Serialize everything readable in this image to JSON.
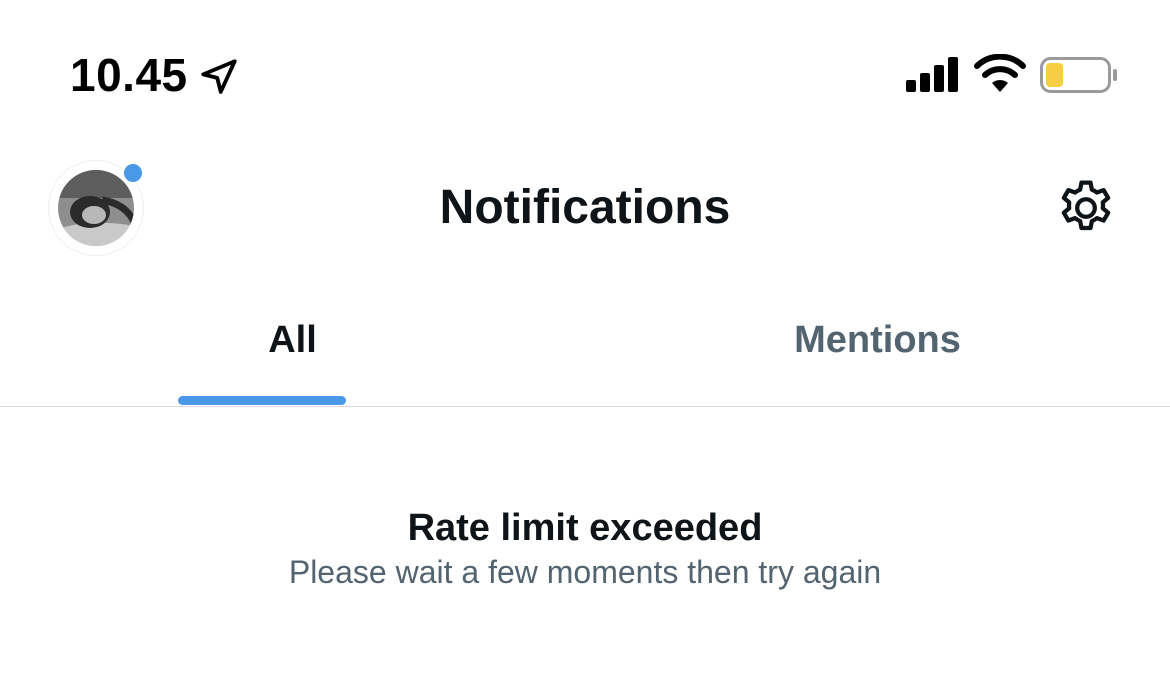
{
  "status_bar": {
    "time": "10.45",
    "icons": [
      "location-arrow-icon",
      "cellular-signal-icon",
      "wifi-icon",
      "battery-icon"
    ],
    "battery_color": "#f5ce42"
  },
  "header": {
    "title": "Notifications",
    "avatar": "profile-avatar",
    "notification_dot_color": "#4a99e9",
    "settings_icon": "gear-icon"
  },
  "tabs": {
    "items": [
      {
        "label": "All",
        "selected": true
      },
      {
        "label": "Mentions",
        "selected": false
      }
    ],
    "indicator_color": "#4a99e9"
  },
  "message": {
    "title": "Rate limit exceeded",
    "subtitle": "Please wait a few moments then try again"
  },
  "colors": {
    "primary_text": "#0f1419",
    "secondary_text": "#536471",
    "accent": "#4a99e9"
  }
}
